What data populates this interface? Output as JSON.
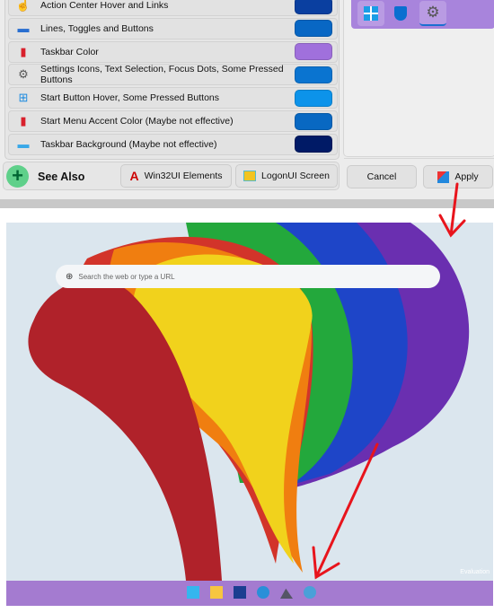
{
  "color_rows": [
    {
      "label": "Action Center Hover and Links",
      "icon": "hand-pointer-icon",
      "color": "#0a3fa0"
    },
    {
      "label": "Lines, Toggles and Buttons",
      "icon": "keyboard-icon",
      "color": "#0867c4"
    },
    {
      "label": "Taskbar Color",
      "icon": "taskbar-red-icon",
      "color": "#a070dc"
    },
    {
      "label": "Settings Icons, Text Selection, Focus Dots, Some Pressed Buttons",
      "icon": "gear-icon",
      "color": "#0a74d0"
    },
    {
      "label": "Start Button Hover, Some Pressed Buttons",
      "icon": "windows-logo-icon",
      "color": "#0c93ea"
    },
    {
      "label": "Start Menu Accent Color (Maybe not effective)",
      "icon": "taskbar-red-icon",
      "color": "#0868c2"
    },
    {
      "label": "Taskbar Background (Maybe not effective)",
      "icon": "monitor-icon",
      "color": "#001a66"
    }
  ],
  "see_also": {
    "label": "See Also",
    "win32": "Win32UI Elements",
    "logon": "LogonUI Screen"
  },
  "actions": {
    "cancel": "Cancel",
    "apply": "Apply"
  },
  "desktop": {
    "search_placeholder": "Search the web or type a URL",
    "watermark": "Evaluation",
    "taskbar_color": "#a47bd0"
  }
}
